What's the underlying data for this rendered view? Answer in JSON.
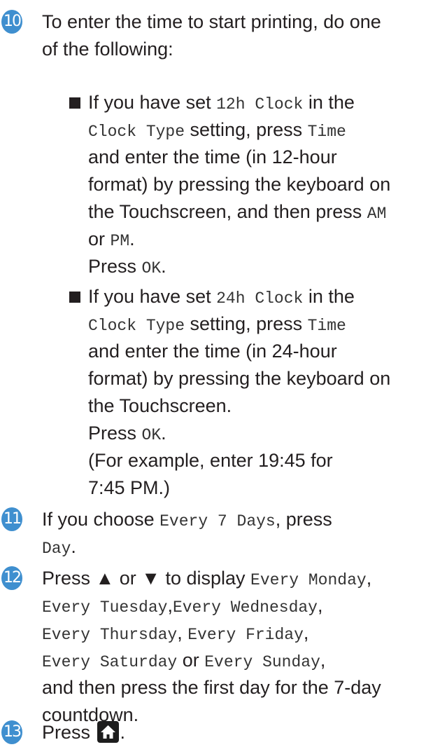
{
  "top_clip": "",
  "step10": {
    "number": "10",
    "line1": "To enter the time to start printing, do one",
    "line2": "of the following:",
    "bullet1": {
      "a1": "If you have set ",
      "m1": "12h Clock",
      "a2": " in the",
      "m2": "Clock Type",
      "a3": " setting, press ",
      "m3": "Time",
      "l3": "and enter the time (in 12-hour",
      "l4": "format) by pressing the keyboard on",
      "l5a": "the Touchscreen, and then press ",
      "m5": "AM",
      "l6a": "or ",
      "m6": "PM",
      "l6b": ".",
      "l7a": "Press ",
      "m7": "OK",
      "l7b": "."
    },
    "bullet2": {
      "a1": "If you have set ",
      "m1": "24h Clock",
      "a2": " in the",
      "m2": "Clock Type",
      "a3": " setting, press ",
      "m3": "Time",
      "l3": "and enter the time (in 24-hour",
      "l4": "format) by pressing the keyboard on",
      "l5": "the Touchscreen.",
      "l6a": "Press ",
      "m6": "OK",
      "l6b": ".",
      "l7": "(For example, enter 19:45 for",
      "l8": "7:45 PM.)"
    }
  },
  "step11": {
    "number": "11",
    "a1": "If you choose ",
    "m1": "Every 7 Days",
    "a2": ", press",
    "m2": "Day",
    "a3": "."
  },
  "step12": {
    "number": "12",
    "a1": "Press ▲ or ▼ to display ",
    "m1": "Every Monday",
    "a2": ",",
    "m2": "Every Tuesday",
    "a3": ",",
    "m3": "Every Wednesday",
    "a4": ",",
    "m4": "Every Thursday",
    "a5": ", ",
    "m5": "Every Friday",
    "a6": ",",
    "m6": "Every Saturday",
    "a7": " or ",
    "m7": "Every Sunday",
    "a8": ",",
    "l5": "and then press the first day for the 7-day",
    "l6": "countdown."
  },
  "step13": {
    "number": "13",
    "a1": "Press ",
    "icon": "home-icon",
    "a2": "."
  }
}
